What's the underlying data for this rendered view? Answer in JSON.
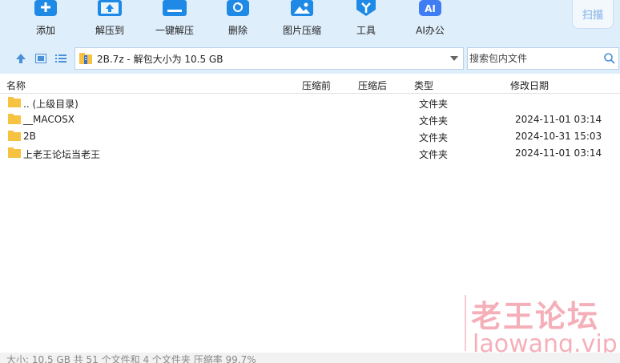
{
  "toolbar": {
    "items": [
      {
        "label": "添加",
        "icon": "add-icon"
      },
      {
        "label": "解压到",
        "icon": "extract-to-icon"
      },
      {
        "label": "一键解压",
        "icon": "one-click-extract-icon"
      },
      {
        "label": "删除",
        "icon": "delete-icon"
      },
      {
        "label": "图片压缩",
        "icon": "image-compress-icon"
      },
      {
        "label": "工具",
        "icon": "tools-icon"
      },
      {
        "label": "AI办公",
        "icon": "ai-office-icon"
      }
    ],
    "scan_label": "扫描"
  },
  "address": {
    "path": "2B.7z - 解包大小为 10.5 GB",
    "search_placeholder": "搜索包内文件"
  },
  "columns": {
    "name": "名称",
    "before": "压缩前",
    "after": "压缩后",
    "type": "类型",
    "modified": "修改日期"
  },
  "rows": [
    {
      "name": ".. (上级目录)",
      "type": "文件夹",
      "date": ""
    },
    {
      "name": "__MACOSX",
      "type": "文件夹",
      "date": "2024-11-01 03:14"
    },
    {
      "name": "2B",
      "type": "文件夹",
      "date": "2024-10-31 15:03"
    },
    {
      "name": "上老王论坛当老王",
      "type": "文件夹",
      "date": "2024-11-01 03:14"
    }
  ],
  "status": {
    "text": "大小: 10.5 GB 共 51 个文件和 4 个文件夹 压缩率 99.7%"
  },
  "watermark": {
    "cn": "老王论坛",
    "en": "laowang.vip"
  },
  "colors": {
    "toolbar_bg": "#dfeefb",
    "icon_blue": "#1f8ae6",
    "folder": "#f5c242",
    "watermark": "#e94d63"
  }
}
